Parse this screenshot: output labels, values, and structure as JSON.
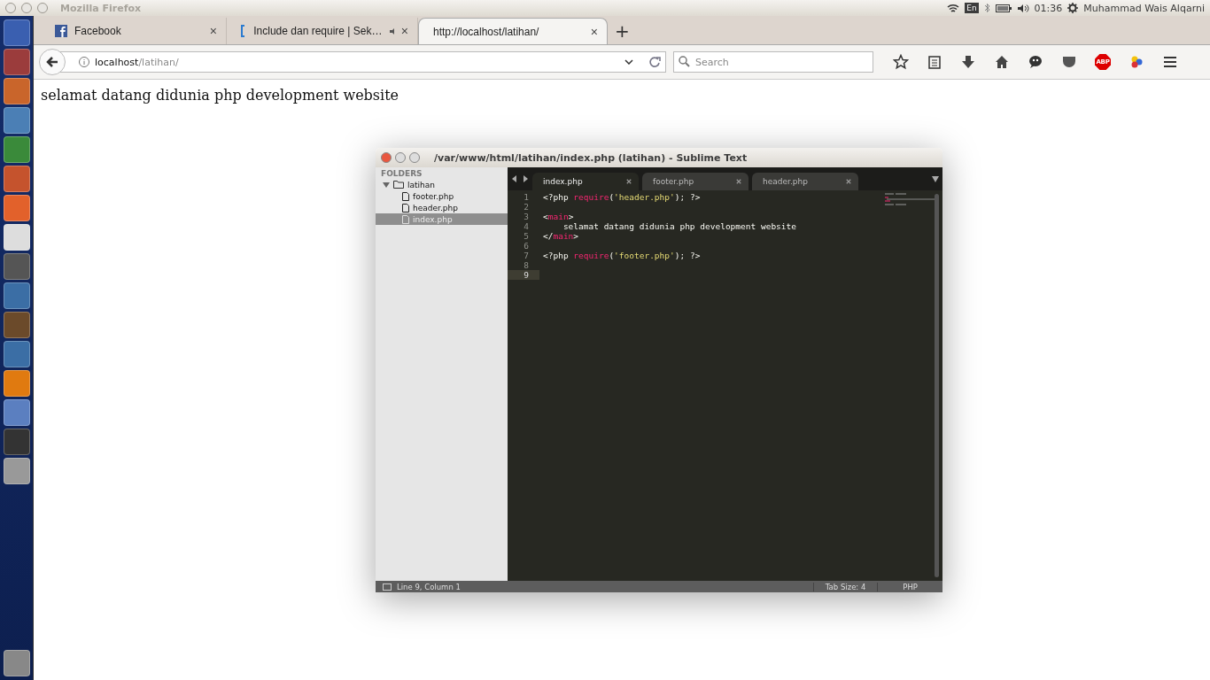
{
  "top_panel": {
    "title": "Mozilla Firefox",
    "keyboard": "En",
    "time": "01:36",
    "user": "Muhammad Wais Alqarni"
  },
  "browser": {
    "tabs": [
      {
        "label": "Facebook",
        "selected": false,
        "kind": "facebook",
        "audio": false,
        "close": "×"
      },
      {
        "label": "Include dan require | Sek…",
        "selected": false,
        "kind": "brackets",
        "audio": true,
        "close": "×"
      },
      {
        "label": "http://localhost/latihan/",
        "selected": true,
        "kind": "plain",
        "audio": false,
        "close": "×"
      }
    ],
    "new_tab": "+",
    "address": {
      "host": "localhost",
      "path": "/latihan/"
    },
    "search": {
      "placeholder": "Search"
    },
    "adblock_label": "ABP",
    "page_text": "selamat datang didunia php development website"
  },
  "editor": {
    "title": "/var/www/html/latihan/index.php (latihan) - Sublime Text",
    "sidebar": {
      "header": "FOLDERS",
      "folders": [
        {
          "name": "latihan",
          "expanded": true,
          "children": [
            {
              "name": "footer.php",
              "selected": false
            },
            {
              "name": "header.php",
              "selected": false
            },
            {
              "name": "index.php",
              "selected": true
            }
          ]
        }
      ]
    },
    "tabs": [
      {
        "label": "index.php",
        "selected": true
      },
      {
        "label": "footer.php",
        "selected": false
      },
      {
        "label": "header.php",
        "selected": false
      }
    ],
    "lines": [
      {
        "number": "1",
        "current": false,
        "tokens": [
          {
            "text": "<?php ",
            "kind": "text"
          },
          {
            "text": "require",
            "kind": "keyword"
          },
          {
            "text": "(",
            "kind": "text"
          },
          {
            "text": "'header.php'",
            "kind": "string"
          },
          {
            "text": "); ?>",
            "kind": "text"
          }
        ]
      },
      {
        "number": "2",
        "current": false
      },
      {
        "number": "3",
        "current": false,
        "tokens": [
          {
            "text": "<",
            "kind": "text"
          },
          {
            "text": "main",
            "kind": "keyword"
          },
          {
            "text": ">",
            "kind": "text"
          }
        ]
      },
      {
        "number": "4",
        "current": false,
        "tokens": [
          {
            "text": "    selamat datang didunia php development website",
            "kind": "text"
          }
        ]
      },
      {
        "number": "5",
        "current": false,
        "tokens": [
          {
            "text": "</",
            "kind": "text"
          },
          {
            "text": "main",
            "kind": "keyword"
          },
          {
            "text": ">",
            "kind": "text"
          }
        ]
      },
      {
        "number": "6",
        "current": false
      },
      {
        "number": "7",
        "current": false,
        "tokens": [
          {
            "text": "<?php ",
            "kind": "text"
          },
          {
            "text": "require",
            "kind": "keyword"
          },
          {
            "text": "(",
            "kind": "text"
          },
          {
            "text": "'footer.php'",
            "kind": "string"
          },
          {
            "text": "); ?>",
            "kind": "text"
          }
        ]
      },
      {
        "number": "8",
        "current": false
      },
      {
        "number": "9",
        "current": true
      }
    ],
    "status": {
      "position": "Line 9, Column 1",
      "tab_size": "Tab Size: 4",
      "syntax": "PHP"
    }
  }
}
